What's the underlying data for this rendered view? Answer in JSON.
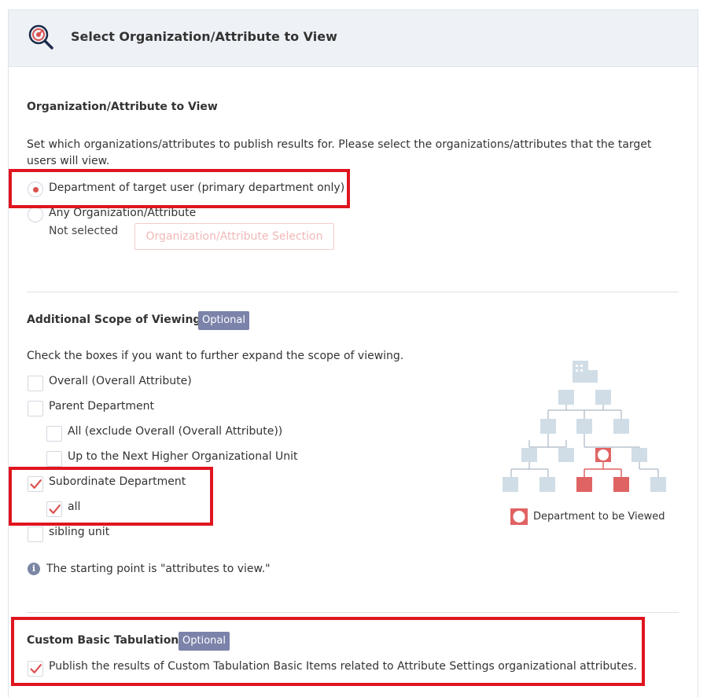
{
  "header": {
    "title": "Select Organization/Attribute to View",
    "icon": "search-target-icon"
  },
  "org_section": {
    "title": "Organization/Attribute to View",
    "description": "Set which organizations/attributes to publish results for. Please select the organizations/attributes that the target users will view.",
    "options": [
      {
        "label": "Department of target user (primary department only)",
        "selected": true
      },
      {
        "label": "Any Organization/Attribute",
        "selected": false
      }
    ],
    "not_selected_text": "Not selected",
    "selection_button": "Organization/Attribute Selection"
  },
  "scope_section": {
    "title": "Additional Scope of Viewing",
    "badge": "Optional",
    "description": "Check the boxes if you want to further expand the scope of viewing.",
    "items": [
      {
        "label": "Overall (Overall Attribute)",
        "checked": false
      },
      {
        "label": "Parent Department",
        "checked": false
      },
      {
        "label": "All (exclude Overall (Overall Attribute))",
        "checked": false
      },
      {
        "label": "Up to the Next Higher Organizational Unit",
        "checked": false
      },
      {
        "label": "Subordinate Department",
        "checked": true
      },
      {
        "label": "all",
        "checked": true
      },
      {
        "label": "sibling unit",
        "checked": false
      }
    ],
    "info_text": "The starting point is \"attributes to view.\"",
    "legend_label": "Department to be Viewed"
  },
  "custom_section": {
    "title": "Custom Basic Tabulation",
    "badge": "Optional",
    "checkbox_label": "Publish the results of Custom Tabulation Basic Items related to Attribute Settings organizational attributes.",
    "checked": true
  },
  "colors": {
    "accent": "#d9514e",
    "highlight": "#e0151f",
    "badge": "#7b83aa",
    "tree_node": "#d0dde6",
    "tree_node_active": "#e06363"
  }
}
